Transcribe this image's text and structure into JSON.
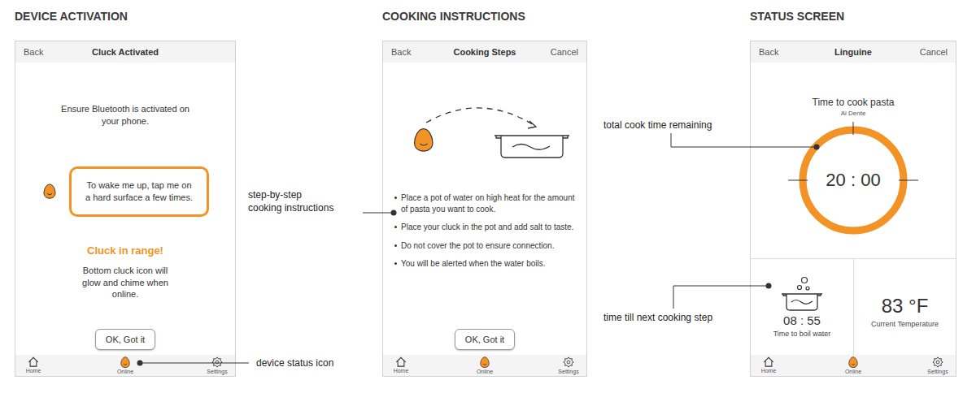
{
  "tab_bar": [
    {
      "label": "Home",
      "kind": "home",
      "selected": false
    },
    {
      "label": "Online",
      "kind": "cluck",
      "selected": true
    },
    {
      "label": "Settings",
      "kind": "settings",
      "selected": false
    }
  ],
  "screens": [
    {
      "kind": "activation",
      "heading": "DEVICE ACTIVATION",
      "nav": {
        "back": "Back",
        "title": "Cluck Activated"
      },
      "intro": "Ensure Bluetooth is activated on your phone.",
      "tip": "To wake me up, tap me on a hard surface a few times.",
      "status": "Cluck in range!",
      "note": "Bottom cluck icon will glow and chime when online.",
      "button": "OK, Got it",
      "annotations": [
        {
          "lines": [
            "device status icon"
          ]
        }
      ]
    },
    {
      "kind": "instructions",
      "heading": "COOKING INSTRUCTIONS",
      "nav": {
        "back": "Back",
        "title": "Cooking Steps",
        "cancel": "Cancel"
      },
      "steps": [
        "Place a pot of water on high heat for the amount of pasta you want to cook.",
        "Place your cluck in the pot and add salt to taste.",
        "Do not cover the pot to ensure connection.",
        "You will be alerted when the water boils."
      ],
      "button": "OK, Got it",
      "annotations": [
        {
          "lines": [
            "step-by-step",
            "cooking instructions"
          ]
        }
      ]
    },
    {
      "kind": "status",
      "heading": "STATUS SCREEN",
      "nav": {
        "back": "Back",
        "title": "Linguine",
        "cancel": "Cancel"
      },
      "title": "Time to cook pasta",
      "subtitle": "Al Dente",
      "timer": "20 : 00",
      "level": 1,
      "next_step": {
        "time": "08 : 55",
        "label": "Time to boil water"
      },
      "temperature": {
        "value": "83 °F",
        "label": "Current Temperature"
      },
      "annotations": [
        {
          "lines": [
            "total cook time remaining"
          ]
        },
        {
          "lines": [
            "time till next cooking step"
          ]
        }
      ]
    }
  ]
}
